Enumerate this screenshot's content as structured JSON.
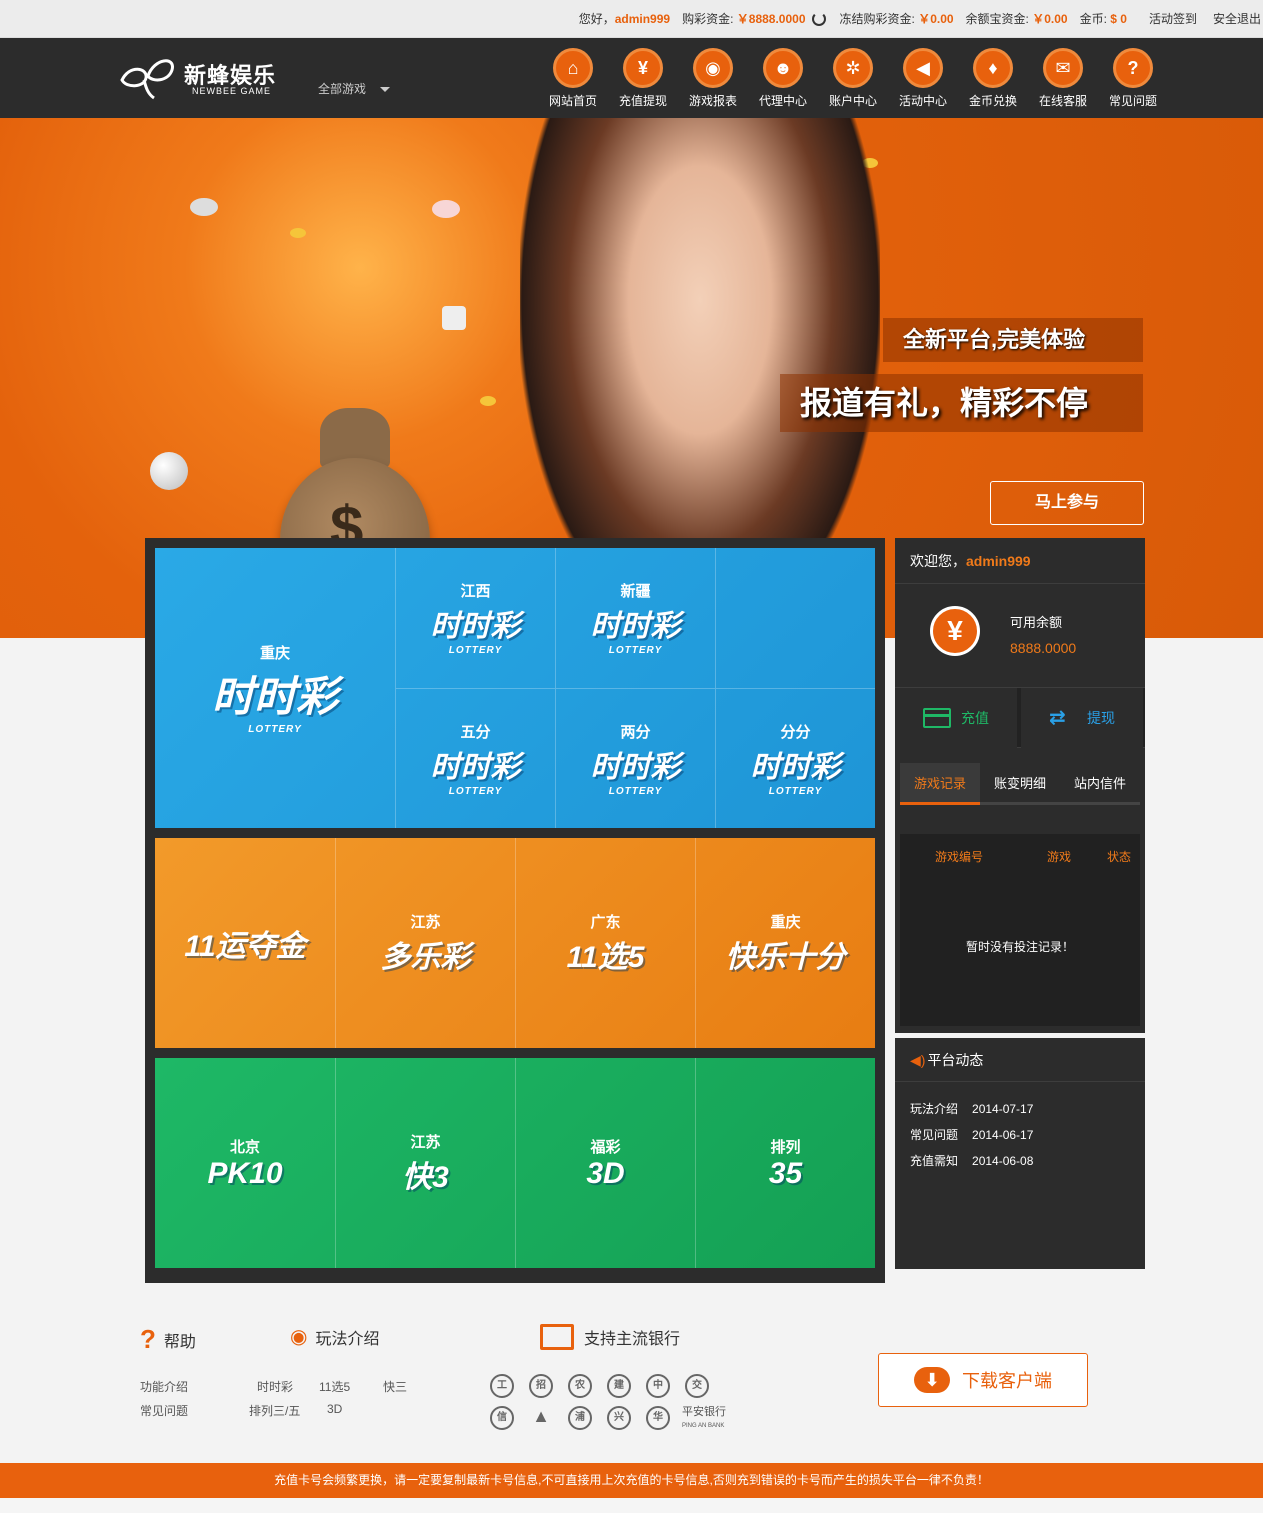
{
  "topbar": {
    "greeting": "您好，",
    "username": "admin999",
    "lottery_funds_label": "购彩资金:",
    "lottery_funds": "￥8888.0000",
    "frozen_label": "冻结购彩资金:",
    "frozen": "￥0.00",
    "yuebao_label": "余额宝资金:",
    "yuebao": "￥0.00",
    "gold_label": "金币:",
    "gold": "$ 0",
    "checkin": "活动签到",
    "logout": "安全退出"
  },
  "logo": {
    "name": "新蜂娱乐",
    "en": "NEWBEE GAME"
  },
  "all_games": "全部游戏",
  "menu": [
    {
      "label": "网站首页",
      "icon": "⌂"
    },
    {
      "label": "充值提现",
      "icon": "¥"
    },
    {
      "label": "游戏报表",
      "icon": "◉"
    },
    {
      "label": "代理中心",
      "icon": "☻"
    },
    {
      "label": "账户中心",
      "icon": "✲"
    },
    {
      "label": "活动中心",
      "icon": "◀"
    },
    {
      "label": "金币兑换",
      "icon": "♦"
    },
    {
      "label": "在线客服",
      "icon": "✉"
    },
    {
      "label": "常见问题",
      "icon": "?"
    }
  ],
  "banner": {
    "slogan1": "全新平台,完美体验",
    "slogan2": "报道有礼，精彩不停",
    "cta": "马上参与"
  },
  "games": {
    "ssc": [
      {
        "sub": "重庆",
        "main": "时时彩",
        "tiny": "LOTTERY"
      },
      {
        "sub": "江西",
        "main": "时时彩",
        "tiny": "LOTTERY"
      },
      {
        "sub": "新疆",
        "main": "时时彩",
        "tiny": "LOTTERY"
      },
      {
        "sub": "五分",
        "main": "时时彩",
        "tiny": "LOTTERY"
      },
      {
        "sub": "两分",
        "main": "时时彩",
        "tiny": "LOTTERY"
      },
      {
        "sub": "分分",
        "main": "时时彩",
        "tiny": "LOTTERY"
      }
    ],
    "orange": [
      {
        "sub": "",
        "main": "11运夺金"
      },
      {
        "sub": "江苏",
        "main": "多乐彩"
      },
      {
        "sub": "广东",
        "main": "11选5"
      },
      {
        "sub": "重庆",
        "main": "快乐十分"
      }
    ],
    "green": [
      {
        "sub": "北京",
        "main": "PK10"
      },
      {
        "sub": "江苏",
        "main": "快3"
      },
      {
        "sub": "福彩",
        "main": "3D"
      },
      {
        "sub": "排列",
        "main": "35"
      }
    ]
  },
  "account": {
    "welcome": "欢迎您，",
    "username": "admin999",
    "balance_label": "可用余额",
    "balance": "8888.0000",
    "recharge": "充值",
    "withdraw": "提现",
    "tabs": [
      "游戏记录",
      "账变明细",
      "站内信件"
    ],
    "cols": [
      "游戏编号",
      "游戏",
      "状态"
    ],
    "empty": "暂时没有投注记录！"
  },
  "news": {
    "title": "平台动态",
    "items": [
      {
        "title": "玩法介绍",
        "date": "2014-07-17"
      },
      {
        "title": "常见问题",
        "date": "2014-06-17"
      },
      {
        "title": "充值需知",
        "date": "2014-06-08"
      }
    ]
  },
  "footer": {
    "help": "帮助",
    "help_links": [
      "功能介绍",
      "常见问题"
    ],
    "play": "玩法介绍",
    "play_links": [
      "时时彩",
      "11选5",
      "快三",
      "排列三/五",
      "3D"
    ],
    "banks_title": "支持主流银行",
    "pingan": "平安银行",
    "pingan_en": "PING AN BANK",
    "download": "下载客户端"
  },
  "notice": "充值卡号会频繁更换，请一定要复制最新卡号信息,不可直接用上次充值的卡号信息,否则充到错误的卡号而产生的损失平台一律不负责！",
  "colors": {
    "accent": "#e8610d",
    "dark": "#2c2c2c",
    "blue": "#2aa9e6",
    "orange": "#f29a2a",
    "green": "#1eb866"
  }
}
